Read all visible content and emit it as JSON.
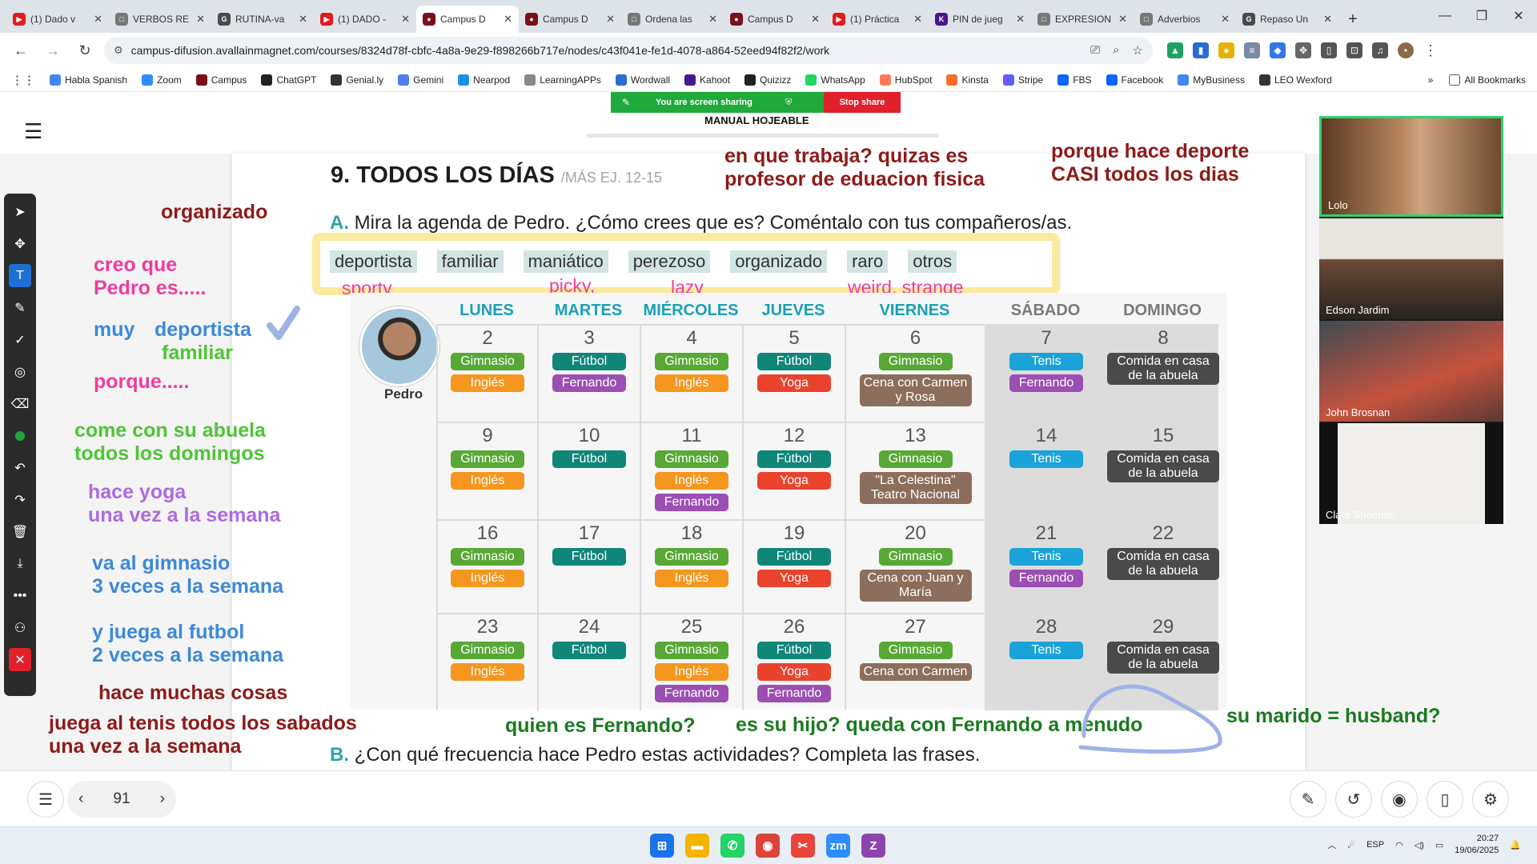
{
  "tabs": [
    {
      "title": "(1) Dado v",
      "color": "#e21c1c",
      "glyph": "▶"
    },
    {
      "title": "VERBOS RE",
      "color": "#777777",
      "glyph": "□"
    },
    {
      "title": "RUTINA-va",
      "color": "#4a4a4a",
      "glyph": "G"
    },
    {
      "title": "(1) DADO -",
      "color": "#e21c1c",
      "glyph": "▶"
    },
    {
      "title": "Campus D",
      "color": "#7a0f1b",
      "glyph": "●",
      "active": true
    },
    {
      "title": "Campus D",
      "color": "#7a0f1b",
      "glyph": "●"
    },
    {
      "title": "Ordena las",
      "color": "#777777",
      "glyph": "□"
    },
    {
      "title": "Campus D",
      "color": "#7a0f1b",
      "glyph": "●"
    },
    {
      "title": "(1) Práctica",
      "color": "#e21c1c",
      "glyph": "▶"
    },
    {
      "title": "PIN de jueg",
      "color": "#46178f",
      "glyph": "K"
    },
    {
      "title": "EXPRESION",
      "color": "#777777",
      "glyph": "□"
    },
    {
      "title": "Adverbios",
      "color": "#777777",
      "glyph": "□"
    },
    {
      "title": "Repaso Un",
      "color": "#4a4a4a",
      "glyph": "G"
    }
  ],
  "url": "campus-difusion.avallainmagnet.com/courses/8324d78f-cbfc-4a8a-9e29-f898266b717e/nodes/c43f041e-fe1d-4078-a864-52eed94f82f2/work",
  "bookmarks": [
    {
      "label": "Habla Spanish",
      "color": "#4285f4"
    },
    {
      "label": "Zoom",
      "color": "#2d8cff"
    },
    {
      "label": "Campus",
      "color": "#7a0f1b"
    },
    {
      "label": "ChatGPT",
      "color": "#222222"
    },
    {
      "label": "Genial.ly",
      "color": "#333333"
    },
    {
      "label": "Gemini",
      "color": "#4f7df5"
    },
    {
      "label": "Nearpod",
      "color": "#1b8fe6"
    },
    {
      "label": "LearningAPPs",
      "color": "#888888"
    },
    {
      "label": "Wordwall",
      "color": "#2a6bd6"
    },
    {
      "label": "Kahoot",
      "color": "#46178f"
    },
    {
      "label": "Quizizz",
      "color": "#222222"
    },
    {
      "label": "WhatsApp",
      "color": "#25d366"
    },
    {
      "label": "HubSpot",
      "color": "#ff7a59"
    },
    {
      "label": "Kinsta",
      "color": "#f96e2a"
    },
    {
      "label": "Stripe",
      "color": "#635bff"
    },
    {
      "label": "FBS",
      "color": "#0866ff"
    },
    {
      "label": "Facebook",
      "color": "#0866ff"
    },
    {
      "label": "MyBusiness",
      "color": "#4285f4"
    },
    {
      "label": "LEO Wexford",
      "color": "#333333"
    }
  ],
  "all_bookmarks": "All Bookmarks",
  "share": {
    "text": "You are screen sharing",
    "stop": "Stop share"
  },
  "manual_title": "MANUAL HOJEABLE",
  "exercise": {
    "number_title": "9.  TODOS LOS DÍAS",
    "more": "/MÁS EJ. 12-15",
    "a_letter": "A.",
    "a_text": "Mira la agenda de Pedro. ¿Cómo crees que es? Coméntalo con tus compañeros/as.",
    "b_letter": "B.",
    "b_text": "¿Con qué frecuencia hace Pedro estas actividades? Completa las frases.",
    "adjectives": [
      "deportista",
      "familiar",
      "maniático",
      "perezoso",
      "organizado",
      "raro",
      "otros"
    ],
    "person": "Pedro"
  },
  "english_notes": {
    "sporty": "sporty",
    "picky": "picky,",
    "lazy": "lazy",
    "weird": "weird, strange"
  },
  "calendar": {
    "days": [
      "LUNES",
      "MARTES",
      "MIÉRCOLES",
      "JUEVES",
      "VIERNES",
      "SÁBADO",
      "DOMINGO"
    ],
    "weeks": [
      [
        {
          "n": "2",
          "a": [
            [
              "Gimnasio",
              "gim"
            ],
            [
              "Inglés",
              "ing"
            ]
          ]
        },
        {
          "n": "3",
          "a": [
            [
              "Fútbol",
              "fut"
            ],
            [
              "Fernando",
              "fer"
            ]
          ]
        },
        {
          "n": "4",
          "a": [
            [
              "Gimnasio",
              "gim"
            ],
            [
              "Inglés",
              "ing"
            ]
          ]
        },
        {
          "n": "5",
          "a": [
            [
              "Fútbol",
              "fut"
            ],
            [
              "Yoga",
              "yog"
            ]
          ]
        },
        {
          "n": "6",
          "a": [
            [
              "Gimnasio",
              "gim"
            ],
            [
              "Cena con Carmen y Rosa",
              "cen"
            ]
          ]
        },
        {
          "n": "7",
          "a": [
            [
              "Tenis",
              "ten"
            ],
            [
              "Fernando",
              "fer"
            ]
          ]
        },
        {
          "n": "8",
          "a": [
            [
              "Comida en casa de la abuela",
              "com"
            ]
          ]
        }
      ],
      [
        {
          "n": "9",
          "a": [
            [
              "Gimnasio",
              "gim"
            ],
            [
              "Inglés",
              "ing"
            ]
          ]
        },
        {
          "n": "10",
          "a": [
            [
              "Fútbol",
              "fut"
            ]
          ]
        },
        {
          "n": "11",
          "a": [
            [
              "Gimnasio",
              "gim"
            ],
            [
              "Inglés",
              "ing"
            ],
            [
              "Fernando",
              "fer"
            ]
          ]
        },
        {
          "n": "12",
          "a": [
            [
              "Fútbol",
              "fut"
            ],
            [
              "Yoga",
              "yog"
            ]
          ]
        },
        {
          "n": "13",
          "a": [
            [
              "Gimnasio",
              "gim"
            ],
            [
              "\"La Celestina\" Teatro Nacional",
              "cen"
            ]
          ]
        },
        {
          "n": "14",
          "a": [
            [
              "Tenis",
              "ten"
            ]
          ]
        },
        {
          "n": "15",
          "a": [
            [
              "Comida en casa de la abuela",
              "com"
            ]
          ]
        }
      ],
      [
        {
          "n": "16",
          "a": [
            [
              "Gimnasio",
              "gim"
            ],
            [
              "Inglés",
              "ing"
            ]
          ]
        },
        {
          "n": "17",
          "a": [
            [
              "Fútbol",
              "fut"
            ]
          ]
        },
        {
          "n": "18",
          "a": [
            [
              "Gimnasio",
              "gim"
            ],
            [
              "Inglés",
              "ing"
            ]
          ]
        },
        {
          "n": "19",
          "a": [
            [
              "Fútbol",
              "fut"
            ],
            [
              "Yoga",
              "yog"
            ]
          ]
        },
        {
          "n": "20",
          "a": [
            [
              "Gimnasio",
              "gim"
            ],
            [
              "Cena con Juan y María",
              "cen"
            ]
          ]
        },
        {
          "n": "21",
          "a": [
            [
              "Tenis",
              "ten"
            ],
            [
              "Fernando",
              "fer"
            ]
          ]
        },
        {
          "n": "22",
          "a": [
            [
              "Comida en casa de la abuela",
              "com"
            ]
          ]
        }
      ],
      [
        {
          "n": "23",
          "a": [
            [
              "Gimnasio",
              "gim"
            ],
            [
              "Inglés",
              "ing"
            ]
          ]
        },
        {
          "n": "24",
          "a": [
            [
              "Fútbol",
              "fut"
            ]
          ]
        },
        {
          "n": "25",
          "a": [
            [
              "Gimnasio",
              "gim"
            ],
            [
              "Inglés",
              "ing"
            ],
            [
              "Fernando",
              "fer"
            ]
          ]
        },
        {
          "n": "26",
          "a": [
            [
              "Fútbol",
              "fut"
            ],
            [
              "Yoga",
              "yog"
            ],
            [
              "Fernando",
              "fer"
            ]
          ]
        },
        {
          "n": "27",
          "a": [
            [
              "Gimnasio",
              "gim"
            ],
            [
              "Cena con Carmen",
              "cen"
            ]
          ]
        },
        {
          "n": "28",
          "a": [
            [
              "Tenis",
              "ten"
            ]
          ]
        },
        {
          "n": "29",
          "a": [
            [
              "Comida en casa de la abuela",
              "com"
            ]
          ]
        }
      ]
    ]
  },
  "annotations": {
    "trabaja": "en que trabaja? quizas es\nprofesor de eduacion fisica",
    "deporte": "porque hace deporte\nCASI todos los dias",
    "organizado": "organizado",
    "creo": "creo que\nPedro es.....",
    "muy": "muy",
    "deportista": "deportista",
    "familiar": "familiar",
    "porque": "porque.....",
    "abuela": "come con su abuela\ntodos los domingos",
    "yoga": "hace yoga\nuna vez a la semana",
    "gimnasio": "va al gimnasio\n3 veces a la semana",
    "futbol": "y juega al futbol\n2 veces a la semana",
    "muchas": "hace muchas cosas",
    "tenis": "juega al tenis todos los sabados\nuna vez a la semana",
    "fernando": "quien es Fernando?",
    "hijo": "es su hijo? queda con Fernando a menudo",
    "marido": "su marido = husband?"
  },
  "participants": [
    {
      "name": "Lolo",
      "active": true
    },
    {
      "name": "Edson Jardim"
    },
    {
      "name": "John Brosnan"
    },
    {
      "name": "Clare Sheehan"
    }
  ],
  "pager": {
    "page": "91"
  },
  "taskbar": {
    "lang": "ESP",
    "time": "20:27",
    "date": "19/06/2025"
  }
}
